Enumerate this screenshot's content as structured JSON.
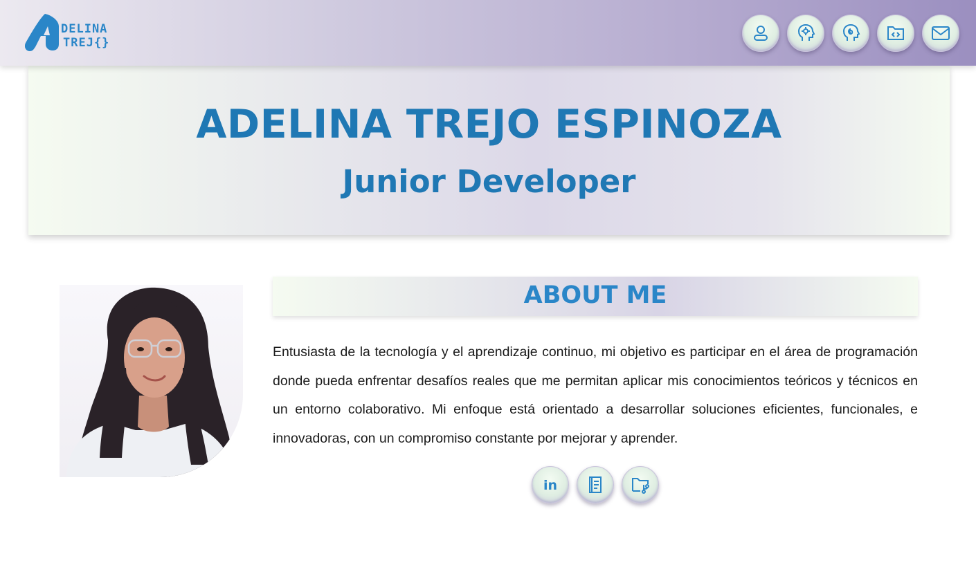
{
  "brand": {
    "logo_line1": "DELINA",
    "logo_line2": "TREJ{}",
    "accent_color": "#1f78b4"
  },
  "nav": {
    "items": [
      {
        "icon": "user-icon"
      },
      {
        "icon": "head-gear-icon"
      },
      {
        "icon": "head-spiral-icon"
      },
      {
        "icon": "folder-code-icon"
      },
      {
        "icon": "mail-icon"
      }
    ]
  },
  "hero": {
    "name": "ADELINA TREJO ESPINOZA",
    "role": "Junior Developer"
  },
  "about": {
    "title": "ABOUT ME",
    "text": "Entusiasta de la tecnología y el aprendizaje continuo, mi objetivo es participar en el área de programación donde pueda enfrentar desafíos reales que me permitan aplicar mis conocimientos teóricos y técnicos en un entorno colaborativo. Mi enfoque está orientado a desarrollar soluciones eficientes, funcionales, e innovadoras, con un compromiso constante por mejorar y aprender."
  },
  "socials": {
    "items": [
      {
        "label": "in",
        "icon": "linkedin-icon"
      },
      {
        "icon": "document-icon"
      },
      {
        "icon": "folder-branch-icon"
      }
    ]
  }
}
